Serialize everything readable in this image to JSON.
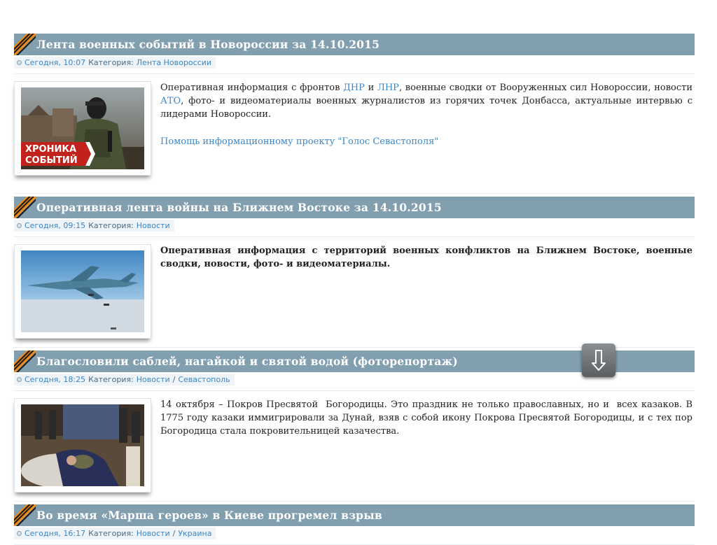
{
  "articles": [
    {
      "title": "Лента военных событий в Новороссии за 14.10.2015",
      "time": "Сегодня, 10:07",
      "category_prefix": "Категория:",
      "categories": [
        "Лента Новороссии"
      ],
      "text_parts": [
        "Оперативная информация с фронтов ",
        "ДНР",
        " и ",
        "ЛНР",
        ", военные сводки от Вооруженных сил Новороссии, новости ",
        "АТО",
        ", фото- и видеоматериалы военных журналистов из горячих точек Донбасса, актуальные интервью с лидерами Новороссии."
      ],
      "help_link": "Помощь информационному проекту \"Голос Севастополя\"",
      "image_caption": [
        "ХРОНИКА",
        "СОБЫТИЙ"
      ]
    },
    {
      "title": "Оперативная лента войны на Ближнем Востоке за 14.10.2015",
      "time": "Сегодня, 09:15",
      "category_prefix": "Категория:",
      "categories": [
        "Новости"
      ],
      "text": "Оперативная информация с территорий военных конфликтов на Ближнем Востоке, военные сводки, новости, фото- и видеоматериалы."
    },
    {
      "title": "Благословили саблей, нагайкой и святой водой (фоторепортаж)",
      "time": "Сегодня, 18:25",
      "category_prefix": "Категория:",
      "categories": [
        "Новости",
        "Севастополь"
      ],
      "text": "14 октября – Покров Пресвятой  Богородицы. Это праздник не только православных, но и  всех казаков. В 1775 году казаки иммигрировали за Дунай, взяв с собой икону Покрова Пресвятой Богородицы, и с тех пор Богородица стала покровительницей казачества."
    },
    {
      "title": "Во время «Марша героев» в Киеве прогремел взрыв",
      "time": "Сегодня, 16:17",
      "category_prefix": "Категория:",
      "categories": [
        "Новости",
        "Украина"
      ]
    }
  ],
  "category_separator": "/",
  "colors": {
    "title_bar": "#829fb0",
    "link": "#3b86c6",
    "meta_bg": "#eef4f8"
  },
  "scroll_button_icon": "arrow-down-icon"
}
